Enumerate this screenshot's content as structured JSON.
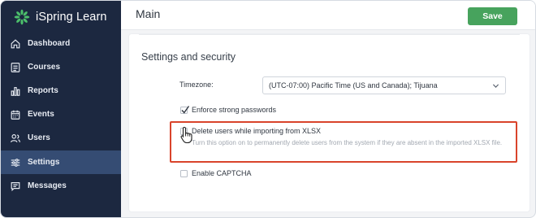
{
  "app": {
    "name": "iSpring Learn",
    "brand_color": "#47a35d"
  },
  "sidebar": {
    "background": "#1c2840",
    "active_color": "#354c73",
    "items": [
      {
        "label": "Dashboard",
        "icon": "home-icon"
      },
      {
        "label": "Courses",
        "icon": "courses-icon"
      },
      {
        "label": "Reports",
        "icon": "reports-icon"
      },
      {
        "label": "Events",
        "icon": "calendar-icon"
      },
      {
        "label": "Users",
        "icon": "users-icon"
      },
      {
        "label": "Settings",
        "icon": "settings-icon",
        "active": true
      },
      {
        "label": "Messages",
        "icon": "messages-icon"
      }
    ]
  },
  "header": {
    "title": "Main",
    "save_label": "Save"
  },
  "settings": {
    "section_title": "Settings and security",
    "timezone": {
      "label": "Timezone:",
      "value": "(UTC-07:00) Pacific Time (US and Canada); Tijuana"
    },
    "options": [
      {
        "label": "Enforce strong passwords",
        "checked": true
      },
      {
        "label": "Delete users while importing from XLSX",
        "checked": false,
        "highlighted": true,
        "description": "Turn this option on to permanently delete users from the system if they are absent in the imported XLSX file."
      },
      {
        "label": "Enable CAPTCHA",
        "checked": false
      }
    ],
    "highlight_color": "#d9442b"
  }
}
